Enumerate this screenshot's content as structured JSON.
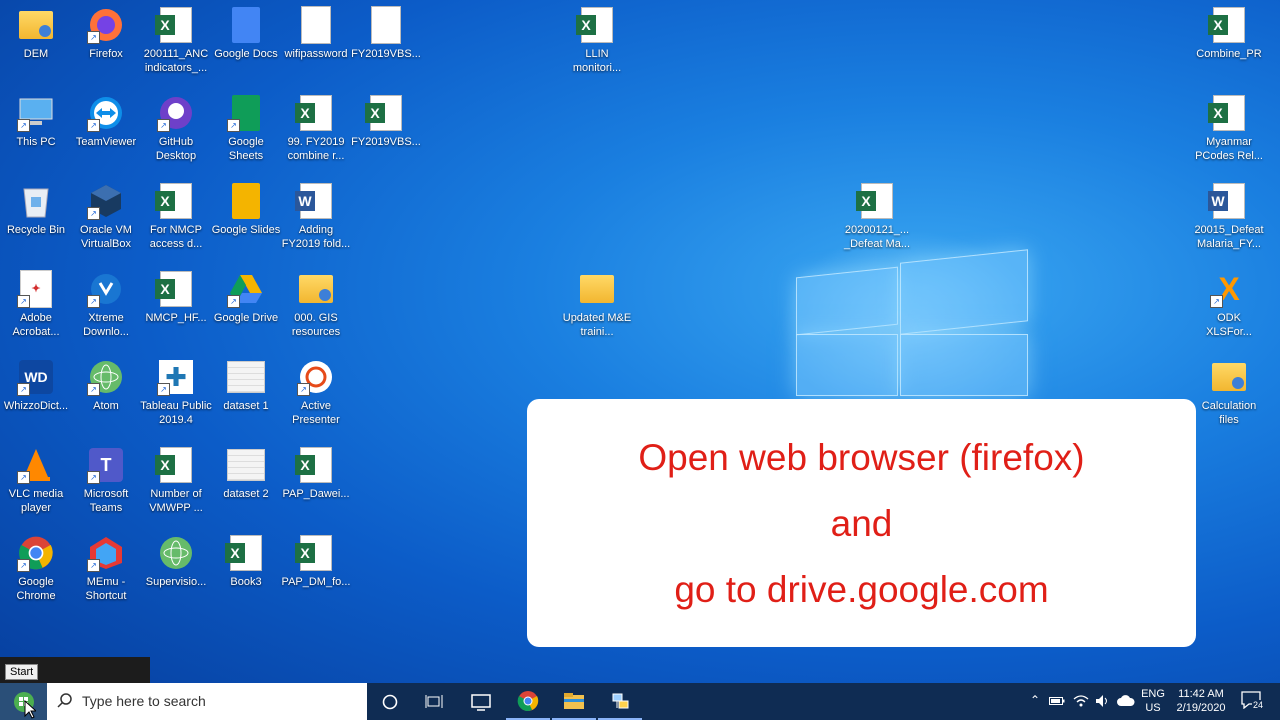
{
  "desktop": {
    "icons": [
      {
        "label": "DEM",
        "icon": "folder-user-icon"
      },
      {
        "label": "Firefox",
        "icon": "firefox-icon"
      },
      {
        "label": "200111_ANC indicators_...",
        "icon": "excel-icon"
      },
      {
        "label": "Google Docs",
        "icon": "google-docs-icon"
      },
      {
        "label": "wifipassword",
        "icon": "text-file-icon"
      },
      {
        "label": "FY2019VBS...",
        "icon": "file-icon"
      },
      {
        "label": "This PC",
        "icon": "computer-icon"
      },
      {
        "label": "TeamViewer",
        "icon": "teamviewer-icon"
      },
      {
        "label": "GitHub Desktop",
        "icon": "github-icon"
      },
      {
        "label": "Google Sheets",
        "icon": "google-sheets-icon"
      },
      {
        "label": "99. FY2019 combine r...",
        "icon": "excel-icon"
      },
      {
        "label": "FY2019VBS...",
        "icon": "excel-icon"
      },
      {
        "label": "Recycle Bin",
        "icon": "recycle-bin-icon"
      },
      {
        "label": "Oracle VM VirtualBox",
        "icon": "virtualbox-icon"
      },
      {
        "label": "For NMCP access d...",
        "icon": "excel-icon"
      },
      {
        "label": "Google Slides",
        "icon": "google-slides-icon"
      },
      {
        "label": "Adding FY2019 fold...",
        "icon": "word-icon"
      },
      {
        "label": "Adobe Acrobat...",
        "icon": "acrobat-icon"
      },
      {
        "label": "Xtreme Downlo...",
        "icon": "xtreme-download-icon"
      },
      {
        "label": "NMCP_HF...",
        "icon": "excel-icon"
      },
      {
        "label": "Google Drive",
        "icon": "google-drive-icon"
      },
      {
        "label": "000. GIS resources",
        "icon": "folder-user-icon"
      },
      {
        "label": "WhizzoDict...",
        "icon": "wd-icon"
      },
      {
        "label": "Atom",
        "icon": "atom-icon"
      },
      {
        "label": "Tableau Public 2019.4",
        "icon": "tableau-icon"
      },
      {
        "label": "dataset 1",
        "icon": "spreadsheet-thumb-icon"
      },
      {
        "label": "Active Presenter",
        "icon": "active-presenter-icon"
      },
      {
        "label": "VLC media player",
        "icon": "vlc-icon"
      },
      {
        "label": "Microsoft Teams",
        "icon": "teams-icon"
      },
      {
        "label": "Number of VMWPP ...",
        "icon": "excel-icon"
      },
      {
        "label": "dataset 2",
        "icon": "spreadsheet-thumb-icon"
      },
      {
        "label": "PAP_Dawei...",
        "icon": "excel-icon"
      },
      {
        "label": "Google Chrome",
        "icon": "chrome-icon"
      },
      {
        "label": "MEmu - Shortcut",
        "icon": "memu-icon"
      },
      {
        "label": "Supervisio...",
        "icon": "atom-icon"
      },
      {
        "label": "Book3",
        "icon": "excel-icon"
      },
      {
        "label": "PAP_DM_fo...",
        "icon": "excel-icon"
      },
      {
        "label": "LLIN monitori...",
        "icon": "excel-icon"
      },
      {
        "label": "Updated M&E traini...",
        "icon": "folder-icon"
      },
      {
        "label": "20200121_... _Defeat Ma...",
        "icon": "excel-icon"
      },
      {
        "label": "Combine_PR",
        "icon": "excel-icon"
      },
      {
        "label": "Myanmar PCodes Rel...",
        "icon": "excel-icon"
      },
      {
        "label": "20015_Defeat Malaria_FY...",
        "icon": "word-icon"
      },
      {
        "label": "ODK XLSFor...",
        "icon": "odk-icon"
      },
      {
        "label": "Calculation files",
        "icon": "folder-user-icon"
      }
    ]
  },
  "instruction_card": {
    "line1": "Open web browser (firefox)",
    "line2": "and",
    "line3": "go to drive.google.com"
  },
  "start_tooltip": "Start",
  "taskbar": {
    "search_placeholder": "Type here to search",
    "pinned": [
      "cortana-icon",
      "task-view-icon",
      "connect-icon",
      "chrome-icon",
      "file-explorer-icon",
      "network-app-icon"
    ],
    "language": "ENG",
    "region": "US",
    "time": "11:42 AM",
    "date": "2/19/2020",
    "notification_count": "24"
  },
  "colors": {
    "card_text": "#e01f17",
    "taskbar": "#0f2c53"
  }
}
